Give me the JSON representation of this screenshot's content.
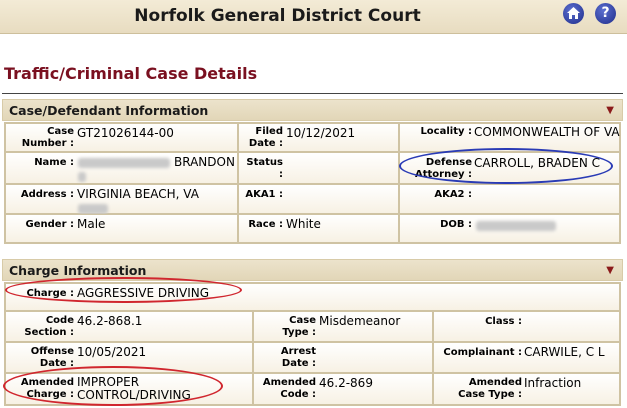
{
  "header": {
    "title": "Norfolk General District Court",
    "home_icon": "home-icon",
    "help_icon": "help-icon",
    "help_glyph": "?"
  },
  "page_title": "Traffic/Criminal Case Details",
  "case_section": {
    "title": "Case/Defendant Information",
    "fields": {
      "case_number": {
        "label_line1": "Case",
        "label_line2": "Number :",
        "value": "GT21026144-00"
      },
      "filed_date": {
        "label_line1": "Filed",
        "label_line2": "Date :",
        "value": "10/12/2021"
      },
      "locality": {
        "label": "Locality :",
        "value": "COMMONWEALTH OF VA"
      },
      "name": {
        "label": "Name :",
        "value": "BRANDON"
      },
      "status": {
        "label": "Status :",
        "value": ""
      },
      "defense_attorney": {
        "label_line1": "Defense",
        "label_line2": "Attorney :",
        "value": "CARROLL, BRADEN C"
      },
      "address": {
        "label": "Address :",
        "value": "VIRGINIA BEACH, VA"
      },
      "aka1": {
        "label": "AKA1 :",
        "value": ""
      },
      "aka2": {
        "label": "AKA2 :",
        "value": ""
      },
      "gender": {
        "label": "Gender :",
        "value": "Male"
      },
      "race": {
        "label": "Race :",
        "value": "White"
      },
      "dob": {
        "label": "DOB :",
        "value": ""
      }
    }
  },
  "charge_section": {
    "title": "Charge Information",
    "fields": {
      "charge": {
        "label": "Charge :",
        "value": "AGGRESSIVE DRIVING"
      },
      "code_section": {
        "label_line1": "Code",
        "label_line2": "Section :",
        "value": "46.2-868.1"
      },
      "case_type": {
        "label_line1": "Case",
        "label_line2": "Type :",
        "value": "Misdemeanor"
      },
      "class": {
        "label": "Class :",
        "value": ""
      },
      "offense_date": {
        "label_line1": "Offense",
        "label_line2": "Date :",
        "value": "10/05/2021"
      },
      "arrest_date": {
        "label_line1": "Arrest",
        "label_line2": "Date :",
        "value": ""
      },
      "complainant": {
        "label": "Complainant :",
        "value": "CARWILE, C L"
      },
      "amended_charge": {
        "label_line1": "Amended",
        "label_line2": "Charge :",
        "value_line1": "IMPROPER",
        "value_line2": "CONTROL/DRIVING"
      },
      "amended_code": {
        "label_line1": "Amended",
        "label_line2": "Code :",
        "value": "46.2-869"
      },
      "amended_case_type": {
        "label_line1": "Amended",
        "label_line2": "Case Type :",
        "value": "Infraction"
      }
    }
  },
  "annotation_colors": {
    "blue": "#2a3bb5",
    "red": "#d0262e"
  }
}
